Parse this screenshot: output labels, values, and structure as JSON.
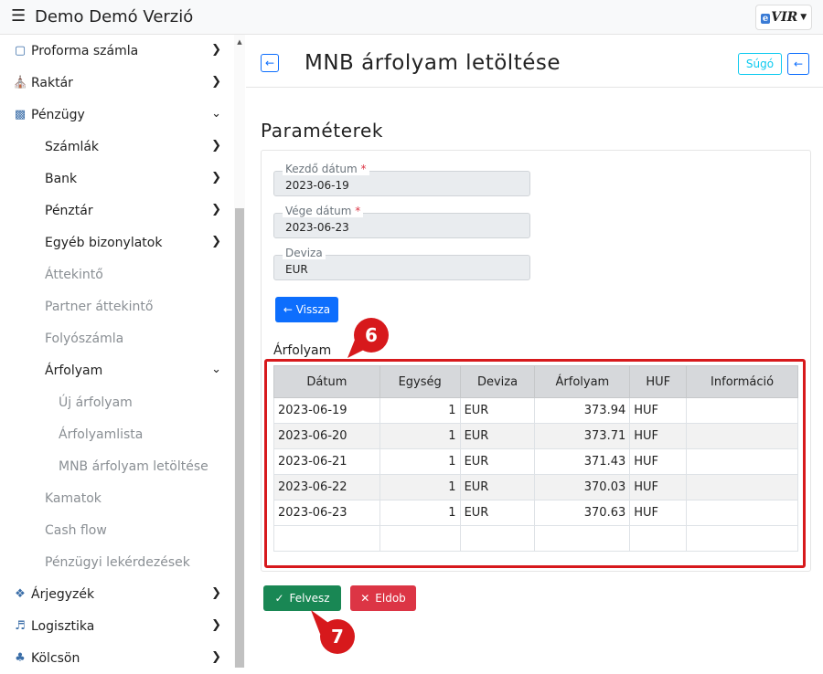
{
  "app": {
    "title": "Demo Demó Verzió",
    "logo_text": "VIR",
    "logo_prefix": "e"
  },
  "sidebar": {
    "items": [
      {
        "label": "Proforma számla",
        "icon": "document-icon"
      },
      {
        "label": "Raktár",
        "icon": "warehouse-icon"
      },
      {
        "label": "Pénzügy",
        "icon": "money-icon"
      },
      {
        "label": "Számlák"
      },
      {
        "label": "Bank"
      },
      {
        "label": "Pénztár"
      },
      {
        "label": "Egyéb bizonylatok"
      },
      {
        "label": "Áttekintő"
      },
      {
        "label": "Partner áttekintő"
      },
      {
        "label": "Folyószámla"
      },
      {
        "label": "Árfolyam"
      },
      {
        "label": "Új árfolyam"
      },
      {
        "label": "Árfolyamlista"
      },
      {
        "label": "MNB árfolyam letöltése"
      },
      {
        "label": "Kamatok"
      },
      {
        "label": "Cash flow"
      },
      {
        "label": "Pénzügyi lekérdezések"
      },
      {
        "label": "Árjegyzék",
        "icon": "tags-icon"
      },
      {
        "label": "Logisztika",
        "icon": "logistics-icon"
      },
      {
        "label": "Kölcsön",
        "icon": "loan-icon"
      }
    ]
  },
  "header": {
    "title": "MNB árfolyam letöltése",
    "help_label": "Súgó"
  },
  "params": {
    "section_title": "Paraméterek",
    "start_date": {
      "label": "Kezdő dátum",
      "value": "2023-06-19"
    },
    "end_date": {
      "label": "Vége dátum",
      "value": "2023-06-23"
    },
    "currency": {
      "label": "Deviza",
      "value": "EUR"
    },
    "back_label": "← Vissza"
  },
  "rates": {
    "label": "Árfolyam",
    "columns": [
      "Dátum",
      "Egység",
      "Deviza",
      "Árfolyam",
      "HUF",
      "Információ"
    ],
    "rows": [
      [
        "2023-06-19",
        "1",
        "EUR",
        "373.94",
        "HUF",
        ""
      ],
      [
        "2023-06-20",
        "1",
        "EUR",
        "373.71",
        "HUF",
        ""
      ],
      [
        "2023-06-21",
        "1",
        "EUR",
        "371.43",
        "HUF",
        ""
      ],
      [
        "2023-06-22",
        "1",
        "EUR",
        "370.03",
        "HUF",
        ""
      ],
      [
        "2023-06-23",
        "1",
        "EUR",
        "370.63",
        "HUF",
        ""
      ],
      [
        "",
        "",
        "",
        "",
        "",
        ""
      ]
    ]
  },
  "actions": {
    "accept_label": "Felvesz",
    "discard_label": "Eldob"
  },
  "annotations": {
    "table_marker": "6",
    "accept_marker": "7"
  },
  "colors": {
    "primary": "#0d6efd",
    "success": "#198754",
    "danger": "#dc3545",
    "callout": "#d7191c"
  }
}
